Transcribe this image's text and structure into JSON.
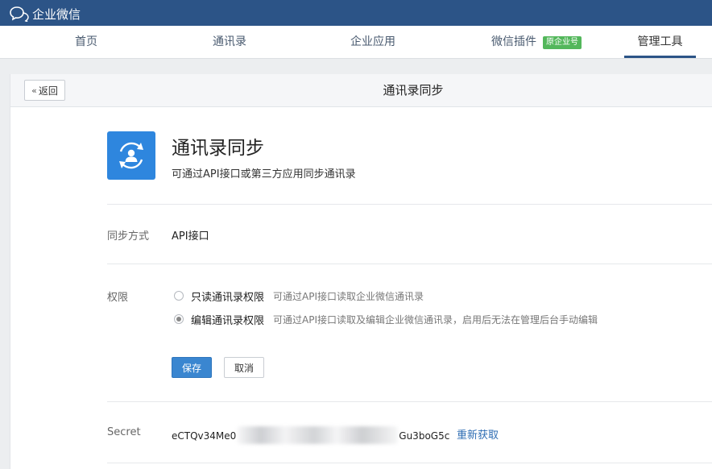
{
  "app": {
    "name": "企业微信"
  },
  "nav": {
    "items": [
      {
        "label": "首页"
      },
      {
        "label": "通讯录"
      },
      {
        "label": "企业应用"
      },
      {
        "label": "微信插件",
        "badge": "原企业号"
      },
      {
        "label": "管理工具"
      }
    ],
    "active": "管理工具"
  },
  "header": {
    "back_label": "返回",
    "title": "通讯录同步"
  },
  "app_info": {
    "title": "通讯录同步",
    "description": "可通过API接口或第三方应用同步通讯录"
  },
  "sync": {
    "label": "同步方式",
    "value": "API接口"
  },
  "permission": {
    "label": "权限",
    "options": [
      {
        "label": "只读通讯录权限",
        "description": "可通过API接口读取企业微信通讯录",
        "checked": false
      },
      {
        "label": "编辑通讯录权限",
        "description": "可通过API接口读取及编辑企业微信通讯录，启用后无法在管理后台手动编辑",
        "checked": true
      }
    ]
  },
  "actions": {
    "save": "保存",
    "cancel": "取消"
  },
  "secret": {
    "label": "Secret",
    "value_start": "eCTQv34Me0",
    "value_end": "Gu3boG5c",
    "refetch": "重新获取"
  },
  "colors": {
    "topbar": "#2c5487",
    "accent": "#3a86d0",
    "badge": "#53b75b",
    "link": "#2e6db3"
  },
  "icons": {
    "logo": "chat-bubble-icon",
    "app": "sync-contacts-icon",
    "back": "double-chevron-left-icon"
  }
}
